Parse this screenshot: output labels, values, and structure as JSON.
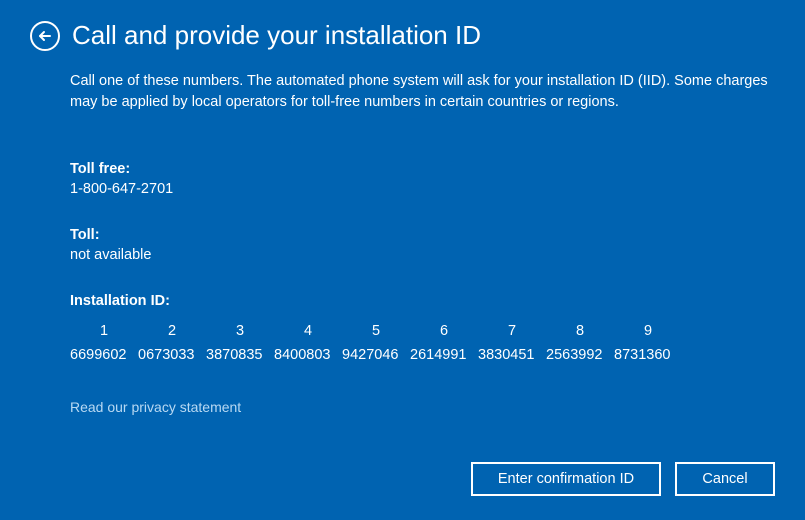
{
  "header": {
    "title": "Call and provide your installation ID"
  },
  "description": "Call one of these numbers. The automated phone system will ask for your installation ID (IID). Some charges may be applied by local operators for toll-free numbers in certain countries or regions.",
  "toll_free": {
    "label": "Toll free:",
    "value": "1-800-647-2701"
  },
  "toll": {
    "label": "Toll:",
    "value": "not available"
  },
  "installation_id": {
    "label": "Installation ID:",
    "headers": [
      "1",
      "2",
      "3",
      "4",
      "5",
      "6",
      "7",
      "8",
      "9"
    ],
    "groups": [
      "6699602",
      "0673033",
      "3870835",
      "8400803",
      "9427046",
      "2614991",
      "3830451",
      "2563992",
      "8731360"
    ]
  },
  "privacy_link": "Read our privacy statement",
  "buttons": {
    "primary": "Enter confirmation ID",
    "cancel": "Cancel"
  }
}
